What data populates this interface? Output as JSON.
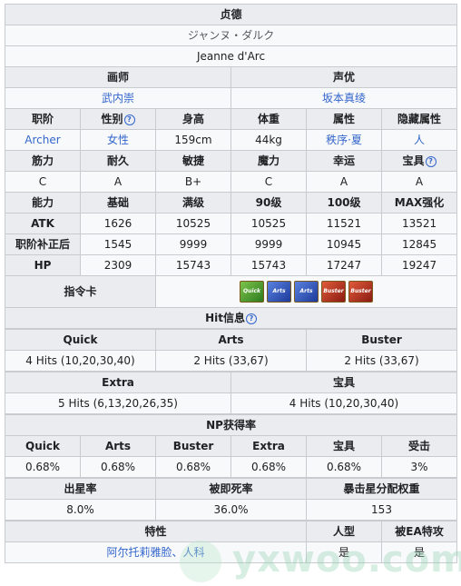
{
  "title": "贞德",
  "name_jp": "ジャンヌ・ダルク",
  "name_en": "Jeanne d'Arc",
  "illustrator": {
    "label": "画师",
    "value": "武内崇"
  },
  "voice_actor": {
    "label": "声优",
    "value": "坂本真绫"
  },
  "profile": {
    "headers": [
      "职阶",
      "性别",
      "身高",
      "体重",
      "属性",
      "隐藏属性"
    ],
    "values": [
      "Archer",
      "女性",
      "159cm",
      "44kg",
      "秩序·夏",
      "人"
    ]
  },
  "params": {
    "headers": [
      "筋力",
      "耐久",
      "敏捷",
      "魔力",
      "幸运",
      "宝具"
    ],
    "values": [
      "C",
      "A",
      "B+",
      "C",
      "A",
      "A"
    ]
  },
  "stats": {
    "headers": [
      "能力",
      "基础",
      "满级",
      "90级",
      "100级",
      "MAX强化"
    ],
    "rows": [
      {
        "label": "ATK",
        "values": [
          "1626",
          "10525",
          "10525",
          "11521",
          "13521"
        ]
      },
      {
        "label": "职阶补正后",
        "values": [
          "1545",
          "9999",
          "9999",
          "10945",
          "12845"
        ]
      },
      {
        "label": "HP",
        "values": [
          "2309",
          "15743",
          "15743",
          "17247",
          "19247"
        ]
      }
    ]
  },
  "command_cards": {
    "label": "指令卡",
    "cards": [
      {
        "type": "q",
        "text": "Quick"
      },
      {
        "type": "a",
        "text": "Arts"
      },
      {
        "type": "a",
        "text": "Arts"
      },
      {
        "type": "b",
        "text": "Buster"
      },
      {
        "type": "b",
        "text": "Buster"
      }
    ]
  },
  "hit_info": {
    "title": "Hit信息",
    "row1_headers": [
      "Quick",
      "Arts",
      "Buster"
    ],
    "row1_values": [
      "4 Hits (10,20,30,40)",
      "2 Hits (33,67)",
      "2 Hits (33,67)"
    ],
    "row2_headers": [
      "Extra",
      "宝具"
    ],
    "row2_values": [
      "5 Hits (6,13,20,26,35)",
      "4 Hits (10,20,30,40)"
    ]
  },
  "np_rate": {
    "title": "NP获得率",
    "headers": [
      "Quick",
      "Arts",
      "Buster",
      "Extra",
      "宝具",
      "受击"
    ],
    "values": [
      "0.68%",
      "0.68%",
      "0.68%",
      "0.68%",
      "0.68%",
      "3%"
    ]
  },
  "star": {
    "headers": [
      "出星率",
      "被即死率",
      "暴击星分配权重"
    ],
    "values": [
      "8.0%",
      "36.0%",
      "153"
    ]
  },
  "traits": {
    "headers": [
      "特性",
      "人型",
      "被EA特攻"
    ],
    "values": [
      "阿尔托莉雅脸、人科",
      "是",
      "是"
    ]
  },
  "watermark": "yxwoo.com",
  "colors": {
    "header_bg": "#eaecf0",
    "value_bg": "#f8f9fa",
    "link": "#3366cc",
    "border": "#c8ccd1"
  }
}
